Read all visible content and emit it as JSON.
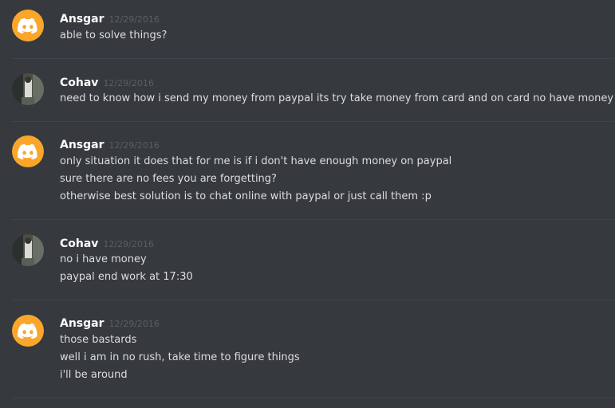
{
  "messages": [
    {
      "author": "Ansgar",
      "timestamp": "12/29/2016",
      "avatar": "discord-logo-icon",
      "lines": [
        "able to solve things?"
      ]
    },
    {
      "author": "Cohav",
      "timestamp": "12/29/2016",
      "avatar": "user-photo",
      "lines": [
        "need to know how i send my money from paypal its try take money from card and on card no have money"
      ]
    },
    {
      "author": "Ansgar",
      "timestamp": "12/29/2016",
      "avatar": "discord-logo-icon",
      "lines": [
        "only situation it does that for me is if i don't have enough money on paypal",
        "sure there are no fees you are forgetting?",
        "otherwise best solution is to chat online with paypal or just call them :p"
      ]
    },
    {
      "author": "Cohav",
      "timestamp": "12/29/2016",
      "avatar": "user-photo",
      "lines": [
        "no i have money",
        "paypal end work at 17:30"
      ]
    },
    {
      "author": "Ansgar",
      "timestamp": "12/29/2016",
      "avatar": "discord-logo-icon",
      "lines": [
        "those bastards",
        "well i am in no rush, take time to figure things",
        "i'll be around"
      ]
    }
  ],
  "colors": {
    "background": "#36393e",
    "discord_avatar": "#f9a62b",
    "username": "#ffffff",
    "message_text": "#dcddde",
    "timestamp": "#5b5e63",
    "divider": "#40444a"
  }
}
